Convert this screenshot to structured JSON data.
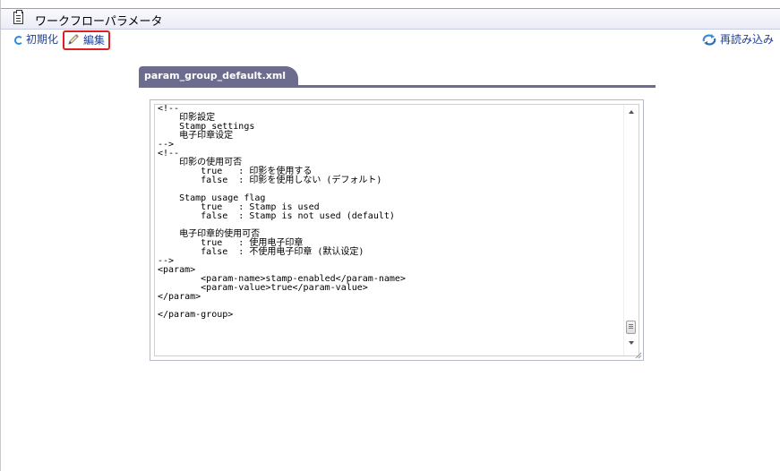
{
  "window": {
    "title": "ワークフローパラメータ",
    "icon": "clipboard-icon"
  },
  "toolbar": {
    "init_label": "初期化",
    "init_icon": "reload-icon",
    "edit_label": "編集",
    "edit_icon": "pencil-icon",
    "reload_label": "再読み込み",
    "reload_icon": "refresh-icon"
  },
  "tab": {
    "label": "param_group_default.xml"
  },
  "editor": {
    "lines": [
      "<!--",
      "    印影設定",
      "    Stamp settings",
      "    电子印章设定",
      "-->",
      "<!--",
      "    印影の使用可否",
      "        true   : 印影を使用する",
      "        false  : 印影を使用しない (デフォルト)",
      "",
      "    Stamp usage flag",
      "        true   : Stamp is used",
      "        false  : Stamp is not used (default)",
      "",
      "    电子印章的使用可否",
      "        true   : 使用电子印章",
      "        false  : 不使用电子印章 (默认设定)",
      "-->",
      "<param>",
      "        <param-name>stamp-enabled</param-name>",
      "        <param-value>true</param-value>",
      "</param>",
      "",
      "</param-group>"
    ]
  },
  "colors": {
    "tab_bg": "#6c6c8e",
    "link": "#1b3f9c",
    "highlight_border": "#e02020"
  }
}
